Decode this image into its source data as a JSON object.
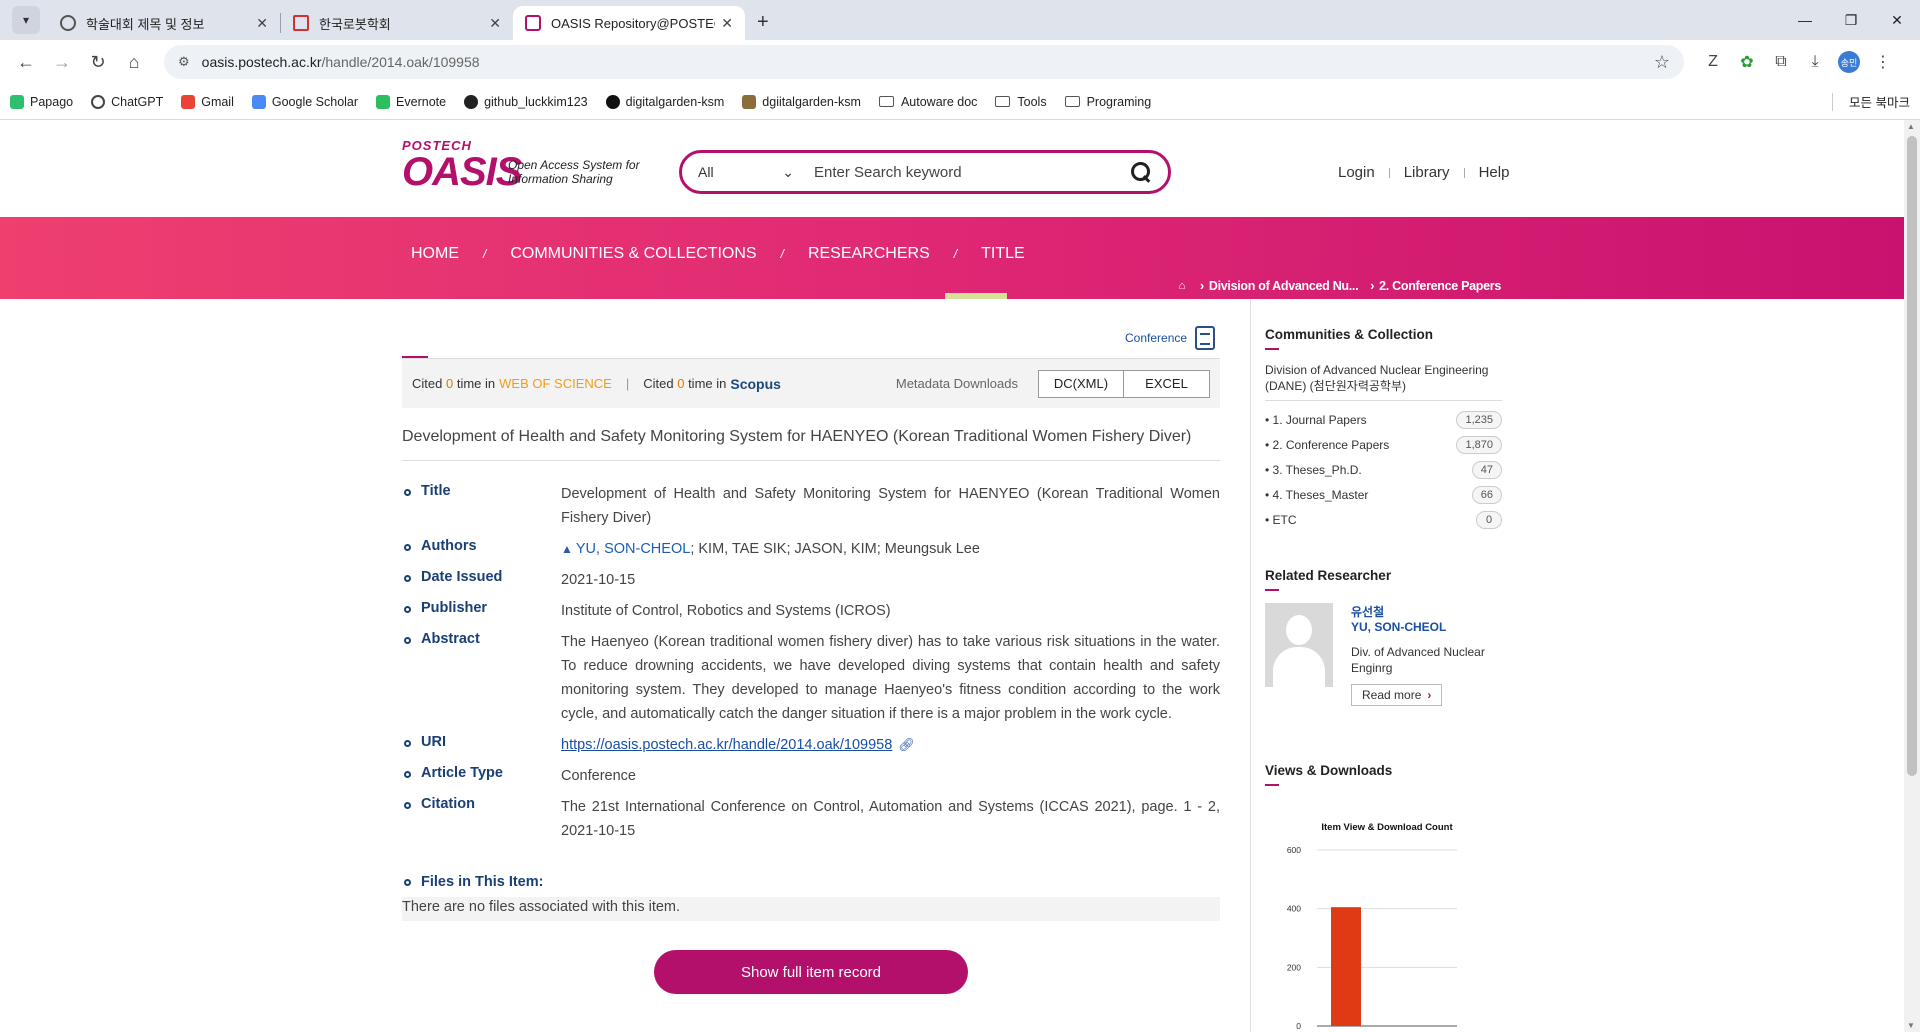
{
  "browser": {
    "tabs": [
      {
        "label": "학술대회 제목 및 정보"
      },
      {
        "label": "한국로봇학회"
      },
      {
        "label": "OASIS Repository@POSTECH: ..."
      }
    ],
    "url_host": "oasis.postech.ac.kr",
    "url_path": "/handle/2014.oak/109958",
    "profile_badge": "송민",
    "bookmarks": [
      "Papago",
      "ChatGPT",
      "Gmail",
      "Google Scholar",
      "Evernote",
      "github_luckkim123",
      "digitalgarden-ksm",
      "dgiitalgarden-ksm",
      "Autoware doc",
      "Tools",
      "Programing"
    ],
    "all_bookmarks": "모든 북마크"
  },
  "header": {
    "logo_top": "POSTECH",
    "logo_main": "OASIS",
    "logo_tagline": "Open Access System for Information Sharing",
    "search_scope": "All",
    "search_placeholder": "Enter Search keyword",
    "links": [
      "Login",
      "Library",
      "Help"
    ]
  },
  "nav": {
    "items": [
      "HOME",
      "COMMUNITIES & COLLECTIONS",
      "RESEARCHERS",
      "TITLE"
    ],
    "active": "TITLE",
    "breadcrumb": [
      "Division of Advanced Nu...",
      "2. Conference Papers"
    ]
  },
  "item": {
    "type_badge": "Conference",
    "cited_wos_pre": "Cited",
    "cited_wos_count": "0",
    "cited_wos_post": "time in",
    "wos_label": "WEB OF SCIENCE",
    "cited_scopus_pre": "Cited",
    "cited_scopus_count": "0",
    "cited_scopus_post": "time in",
    "scopus_label": "Scopus",
    "metadata_downloads": "Metadata Downloads",
    "dc_button": "DC(XML)",
    "excel_button": "EXCEL",
    "heading": "Development of Health and Safety Monitoring System for HAENYEO (Korean Traditional Women Fishery Diver)",
    "fields": {
      "title_label": "Title",
      "title": "Development of Health and Safety Monitoring System for HAENYEO (Korean Traditional Women Fishery Diver)",
      "authors_label": "Authors",
      "author_link": "YU, SON-CHEOL",
      "authors_rest": "; KIM, TAE SIK; JASON, KIM; Meungsuk Lee",
      "date_label": "Date Issued",
      "date": "2021-10-15",
      "publisher_label": "Publisher",
      "publisher": "Institute of Control, Robotics and Systems (ICROS)",
      "abstract_label": "Abstract",
      "abstract": "The Haenyeo (Korean traditional women fishery diver) has to take various risk situations in the water. To reduce drowning accidents, we have developed diving systems that contain health and safety monitoring system. They developed to manage Haenyeo's fitness condition according to the work cycle, and automatically catch the danger situation if there is a major problem in the work cycle.",
      "uri_label": "URI",
      "uri": "https://oasis.postech.ac.kr/handle/2014.oak/109958",
      "article_type_label": "Article Type",
      "article_type": "Conference",
      "citation_label": "Citation",
      "citation": "The 21st International Conference on Control, Automation and Systems (ICCAS 2021), page. 1 - 2, 2021-10-15"
    },
    "files_label": "Files in This Item:",
    "no_files": "There are no files associated with this item.",
    "full_record_button": "Show full item record"
  },
  "sidebar": {
    "collections_title": "Communities & Collection",
    "collection_head": "Division of Advanced Nuclear Engineering (DANE) (첨단원자력공학부)",
    "collections": [
      {
        "label": "• 1. Journal Papers",
        "count": "1,235"
      },
      {
        "label": "• 2. Conference Papers",
        "count": "1,870"
      },
      {
        "label": "• 3. Theses_Ph.D.",
        "count": "47"
      },
      {
        "label": "• 4. Theses_Master",
        "count": "66"
      },
      {
        "label": "• ETC",
        "count": "0"
      }
    ],
    "researcher_title": "Related Researcher",
    "researcher_name_kr": "유선철",
    "researcher_name_en": "YU, SON-CHEOL",
    "researcher_dept": "Div. of Advanced Nuclear Enginrg",
    "read_more": "Read more",
    "views_title": "Views & Downloads"
  },
  "chart_data": {
    "type": "bar",
    "title": "Item View & Download Count",
    "categories": [
      ""
    ],
    "values": [
      405
    ],
    "ylim": [
      0,
      600
    ],
    "yticks": [
      0,
      200,
      400,
      600
    ],
    "grid": true,
    "color": "#e03a14"
  }
}
